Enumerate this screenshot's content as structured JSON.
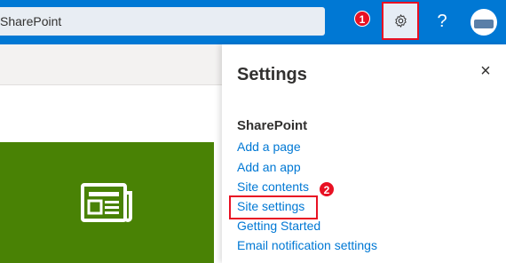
{
  "topbar": {
    "search_value": "SharePoint",
    "help_label": "?"
  },
  "callouts": [
    "1",
    "2"
  ],
  "settings_panel": {
    "title": "Settings",
    "close_label": "×",
    "section_title": "SharePoint",
    "links": [
      "Add a page",
      "Add an app",
      "Site contents",
      "Site settings",
      "Getting Started",
      "Email notification settings"
    ]
  },
  "icons": {
    "gear": "gear-icon",
    "news": "news-icon",
    "avatar": "avatar"
  },
  "colors": {
    "topbar": "#0078d4",
    "accent_red": "#e81123",
    "tile_green": "#498205",
    "link_blue": "#0078d4"
  }
}
